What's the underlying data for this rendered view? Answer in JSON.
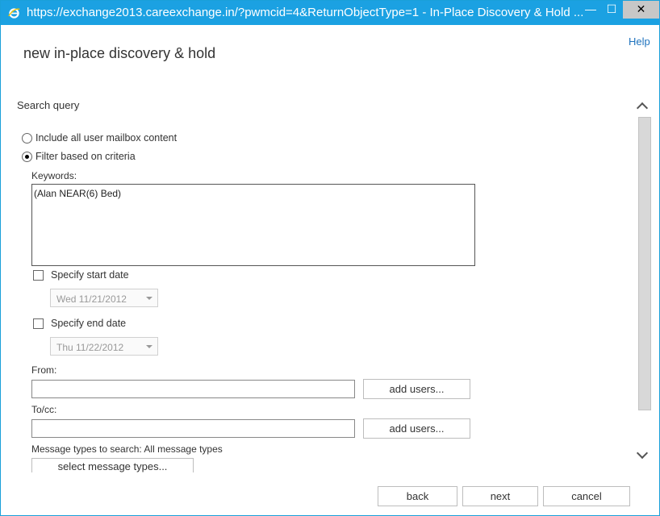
{
  "window": {
    "title": "https://exchange2013.careexchange.in/?pwmcid=4&ReturnObjectType=1 - In-Place Discovery & Hold ...",
    "minimize": "—",
    "maximize": "☐",
    "close": "✕",
    "accent": "#1ba1e2"
  },
  "header": {
    "help": "Help",
    "title": "new in-place discovery & hold"
  },
  "search_query": {
    "title": "Search query",
    "option_all": "Include all user mailbox content",
    "option_filter": "Filter based on criteria",
    "selected": "Filter based on criteria",
    "keywords_label": "Keywords:",
    "keywords_value": "(Alan NEAR(6) Bed)",
    "start_date_label": "Specify start date",
    "start_date_value": "Wed 11/21/2012",
    "start_date_checked": false,
    "end_date_label": "Specify end date",
    "end_date_value": "Thu 11/22/2012",
    "end_date_checked": false,
    "from_label": "From:",
    "from_value": "",
    "from_button": "add users...",
    "tocc_label": "To/cc:",
    "tocc_value": "",
    "tocc_button": "add users...",
    "message_types_label": "Message types to search:",
    "message_types_value": "All message types",
    "message_types_button": "select message types..."
  },
  "footer": {
    "back": "back",
    "next": "next",
    "cancel": "cancel"
  },
  "icons": {
    "browser": "internet-explorer-icon",
    "scroll_up": "chevron-up-icon",
    "scroll_down": "chevron-down-icon"
  }
}
